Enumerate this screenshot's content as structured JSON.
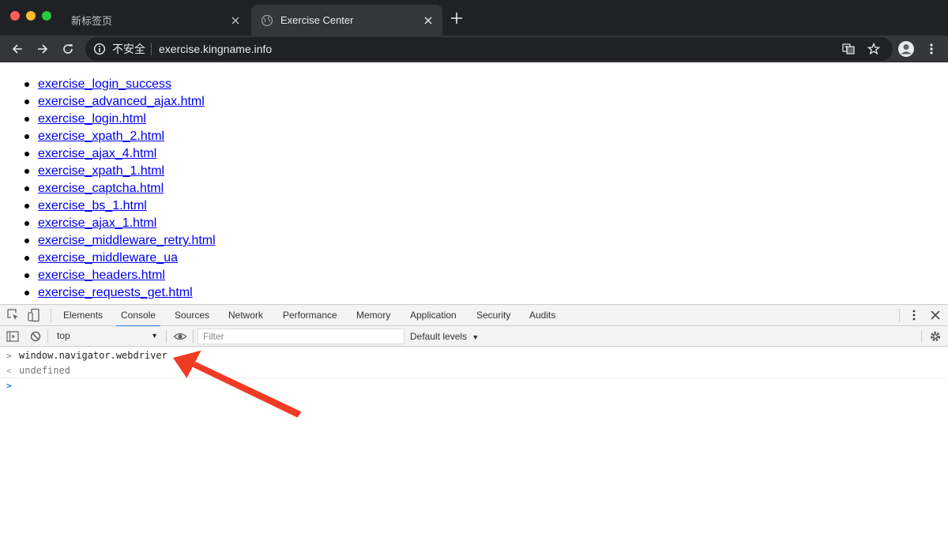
{
  "browser": {
    "tabs": [
      {
        "title": "新标签页",
        "active": false
      },
      {
        "title": "Exercise Center",
        "active": true
      }
    ],
    "address_bar": {
      "security_label": "不安全",
      "url": "exercise.kingname.info"
    },
    "icons": [
      "back-icon",
      "forward-icon",
      "reload-icon",
      "info-icon",
      "translate-icon",
      "star-icon",
      "profile-icon",
      "menu-icon"
    ]
  },
  "page": {
    "links": [
      "exercise_login_success",
      "exercise_advanced_ajax.html",
      "exercise_login.html",
      "exercise_xpath_2.html",
      "exercise_ajax_4.html",
      "exercise_xpath_1.html",
      "exercise_captcha.html",
      "exercise_bs_1.html",
      "exercise_ajax_1.html",
      "exercise_middleware_retry.html",
      "exercise_middleware_ua",
      "exercise_headers.html",
      "exercise_requests_get.html"
    ]
  },
  "devtools": {
    "tabs": [
      "Elements",
      "Console",
      "Sources",
      "Network",
      "Performance",
      "Memory",
      "Application",
      "Security",
      "Audits"
    ],
    "active_tab": "Console",
    "console_bar": {
      "context": "top",
      "filter_placeholder": "Filter",
      "levels": "Default levels"
    },
    "console": {
      "input": "window.navigator.webdriver",
      "output": "undefined"
    }
  },
  "colors": {
    "tabstrip": "#202124",
    "toolbar": "#35363a",
    "link": "#0000ee",
    "devtools_accent": "#1a73e8",
    "annotation_arrow": "#f03a24"
  }
}
